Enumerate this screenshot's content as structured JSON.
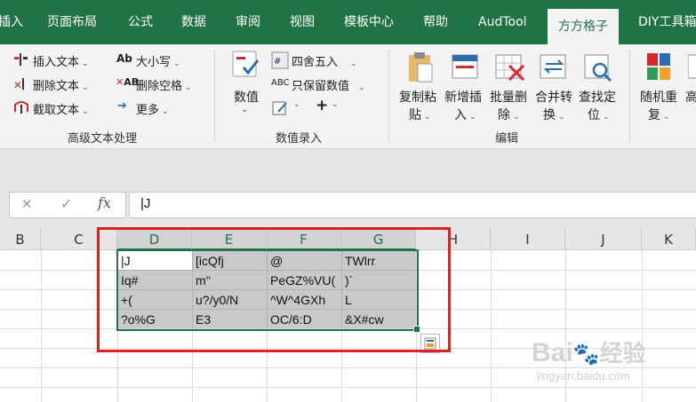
{
  "ribbon_tabs": [
    "插入",
    "页面布局",
    "公式",
    "数据",
    "审阅",
    "视图",
    "模板中心",
    "帮助",
    "AudTool",
    "方方格子",
    "DIY工具箱"
  ],
  "active_tab": "方方格子",
  "text_group": {
    "insert_text": "插入文本",
    "delete_text": "删除文本",
    "cut_text": "截取文本",
    "case": "大小写",
    "delete_space": "删除空格",
    "more": "更多",
    "label": "高级文本处理"
  },
  "value_group": {
    "value": "数值",
    "round": "四舍五入",
    "keep_value": "只保留数值",
    "label": "数值录入"
  },
  "edit_group": {
    "copy_paste": [
      "复制粘",
      "贴"
    ],
    "insert_new": [
      "新增插",
      "入"
    ],
    "batch_delete": [
      "批量删",
      "除"
    ],
    "merge_convert": [
      "合并转",
      "换"
    ],
    "find_locate": [
      "查找定",
      "位"
    ],
    "label": "编辑"
  },
  "random_group": {
    "random_repeat": [
      "随机重",
      "复"
    ],
    "more_cut": "高"
  },
  "formula_bar": {
    "cancel": "✕",
    "enter": "✓",
    "fx": "fx",
    "content": "|J"
  },
  "columns": [
    "B",
    "C",
    "D",
    "E",
    "F",
    "G",
    "H",
    "I",
    "J",
    "K"
  ],
  "cells": [
    [
      "|J",
      "[icQfj",
      "@",
      "TWlrr"
    ],
    [
      "Iq#",
      "m''",
      "PeGZ%VU(",
      ")`"
    ],
    [
      "+(",
      "u?/y0/N",
      "^W^4GXh",
      "L"
    ],
    [
      "?o%G",
      "E3",
      "OC/6:D",
      "&X#cw"
    ]
  ],
  "watermark": {
    "brand": "Bai",
    "brand_cn": "经验",
    "url": "jingyan.baidu.com"
  },
  "colors": {
    "excel_green": "#217346",
    "selection_fill": "#c9c9c9",
    "highlight_red": "#e0201c"
  }
}
